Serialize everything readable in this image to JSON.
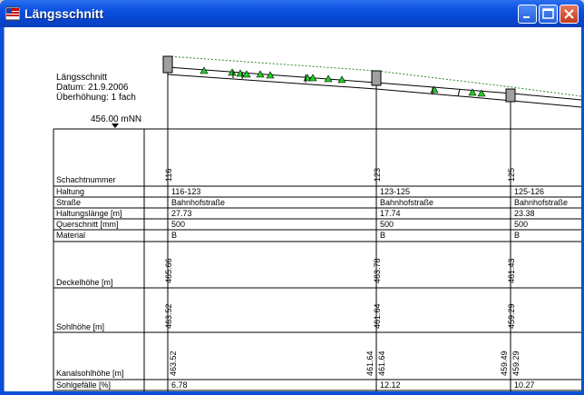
{
  "window": {
    "title": "Längsschnitt"
  },
  "header": {
    "line1": "Längsschnitt",
    "line2": "Datum: 21.9.2006",
    "line3": "Überhöhung: 1 fach",
    "ref_level": "456.00 mNN"
  },
  "rows": {
    "schachtnummer": "Schachtnummer",
    "haltung": "Haltung",
    "strasse": "Straße",
    "haltungslaenge": "Haltungslänge [m]",
    "querschnitt": "Querschnitt [mm]",
    "material": "Material",
    "deckelhoehe": "Deckelhöhe [m]",
    "sohlhoehe": "Sohlhöhe [m]",
    "kanalsohlhoehe": "Kanalsohlhöhe [m]",
    "sohlgefaelle": "Sohlgefälle [%]"
  },
  "schaechte": [
    "116",
    "123",
    "125"
  ],
  "haltungen": [
    {
      "haltung": "116-123",
      "strasse": "Bahnhofstraße",
      "laenge": "27.73",
      "querschnitt": "500",
      "material": "B",
      "gefaelle": "6.78"
    },
    {
      "haltung": "123-125",
      "strasse": "Bahnhofstraße",
      "laenge": "17.74",
      "querschnitt": "500",
      "material": "B",
      "gefaelle": "12.12"
    },
    {
      "haltung": "125-126",
      "strasse": "Bahnhofstraße",
      "laenge": "23.38",
      "querschnitt": "500",
      "material": "B",
      "gefaelle": "10.27"
    }
  ],
  "deckel": [
    "465.66",
    "463.78",
    "461.43"
  ],
  "sohle": [
    "463.52",
    "461.64",
    "459.29"
  ],
  "kanalsohle": {
    "s116": "463.52",
    "s123_in": "461.64",
    "s123_out": "461.64",
    "s125_in": "459.49",
    "s125_out": "459.29"
  },
  "colors": {
    "titlebar": "#0a50e0",
    "ground": "#2e8b2e",
    "marker": "#22cc22"
  }
}
